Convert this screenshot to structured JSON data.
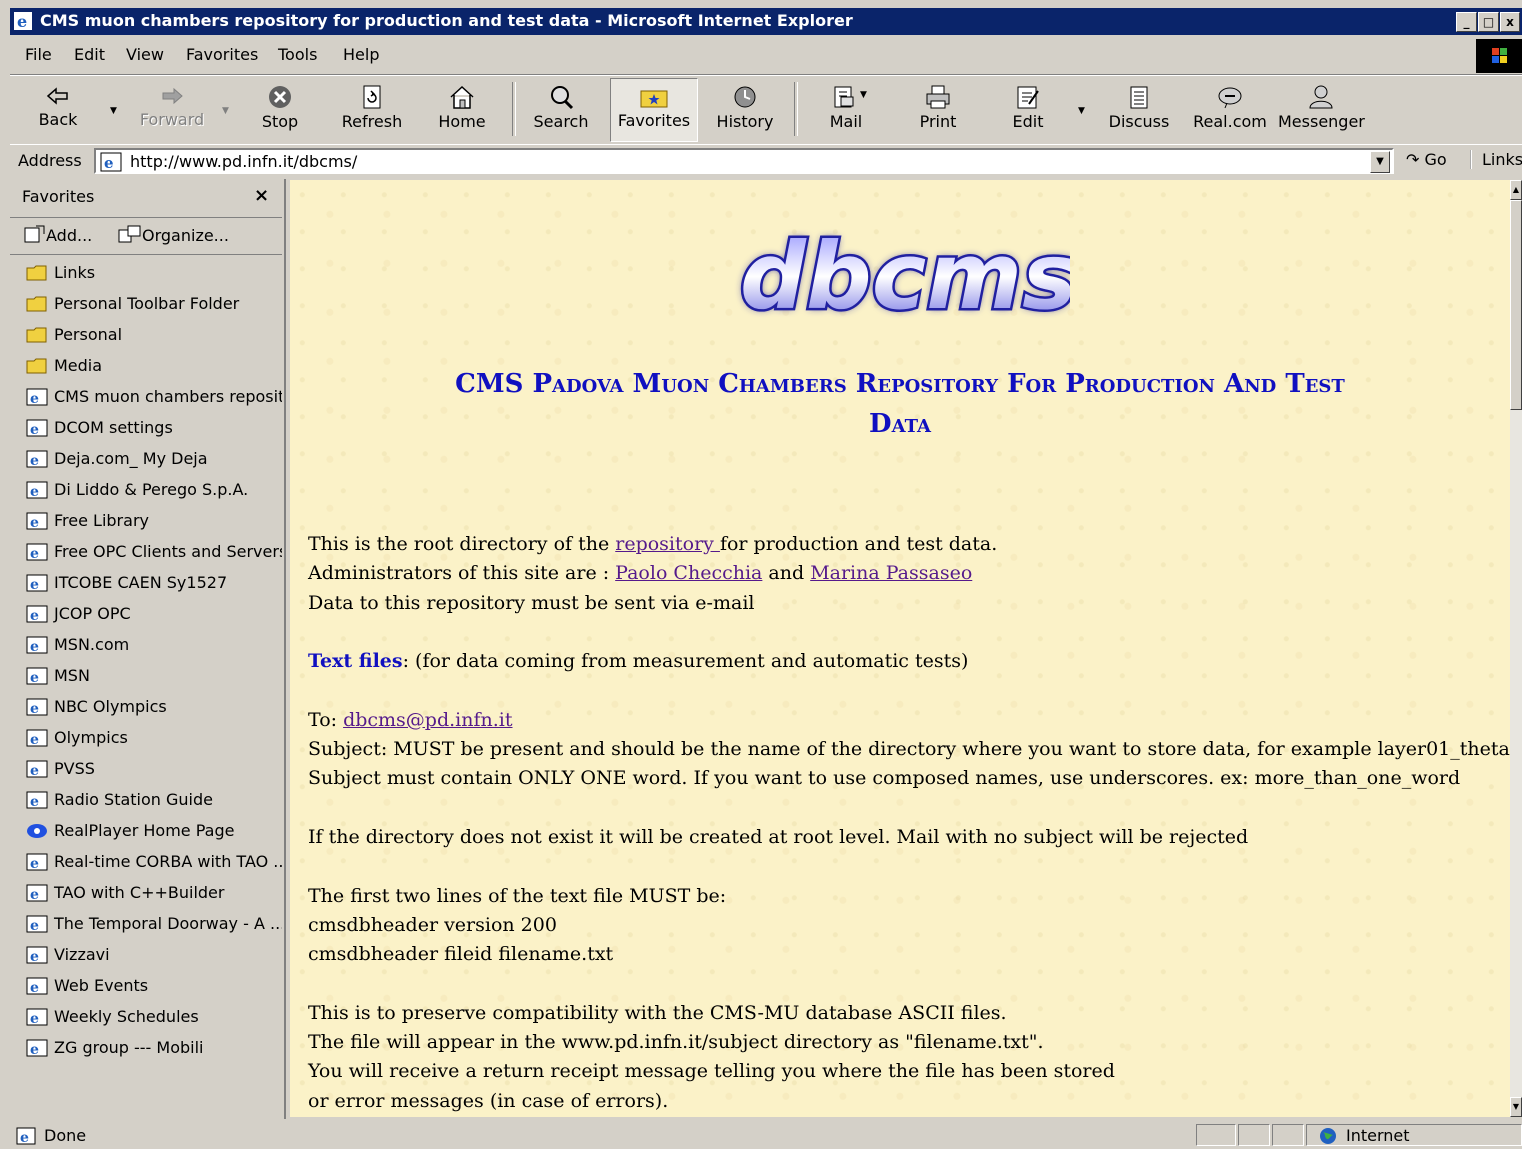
{
  "window": {
    "title": "CMS muon chambers repository for production and test data - Microsoft Internet Explorer",
    "controls": [
      "_",
      "□",
      "x"
    ]
  },
  "menu": [
    "File",
    "Edit",
    "View",
    "Favorites",
    "Tools",
    "Help"
  ],
  "toolbar": {
    "back": "Back",
    "forward": "Forward",
    "stop": "Stop",
    "refresh": "Refresh",
    "home": "Home",
    "search": "Search",
    "favorites": "Favorites",
    "history": "History",
    "mail": "Mail",
    "print": "Print",
    "edit": "Edit",
    "discuss": "Discuss",
    "realcom": "Real.com",
    "messenger": "Messenger"
  },
  "address": {
    "label": "Address",
    "url": "http://www.pd.infn.it/dbcms/",
    "go": "Go",
    "links": "Links"
  },
  "favorites_pane": {
    "title": "Favorites",
    "close": "×",
    "add": "Add...",
    "organize": "Organize...",
    "items": [
      {
        "label": "Links",
        "type": "folder"
      },
      {
        "label": "Personal Toolbar Folder",
        "type": "folder"
      },
      {
        "label": "Personal",
        "type": "folder"
      },
      {
        "label": "Media",
        "type": "folder"
      },
      {
        "label": "CMS muon chambers reposit...",
        "type": "page"
      },
      {
        "label": "DCOM settings",
        "type": "page"
      },
      {
        "label": "Deja.com_ My Deja",
        "type": "page"
      },
      {
        "label": "Di Liddo & Perego S.p.A.",
        "type": "page"
      },
      {
        "label": "Free Library",
        "type": "page"
      },
      {
        "label": "Free OPC Clients and Servers",
        "type": "page"
      },
      {
        "label": "ITCOBE CAEN Sy1527",
        "type": "page"
      },
      {
        "label": "JCOP OPC",
        "type": "page"
      },
      {
        "label": "MSN.com",
        "type": "page"
      },
      {
        "label": "MSN",
        "type": "page"
      },
      {
        "label": "NBC Olympics",
        "type": "page"
      },
      {
        "label": "Olympics",
        "type": "page"
      },
      {
        "label": "PVSS",
        "type": "page"
      },
      {
        "label": "Radio Station Guide",
        "type": "page"
      },
      {
        "label": "RealPlayer Home Page",
        "type": "real"
      },
      {
        "label": "Real-time CORBA with TAO ...",
        "type": "page"
      },
      {
        "label": "TAO with C++Builder",
        "type": "page"
      },
      {
        "label": "The Temporal Doorway - A ...",
        "type": "page"
      },
      {
        "label": "Vizzavi",
        "type": "page"
      },
      {
        "label": "Web Events",
        "type": "page"
      },
      {
        "label": "Weekly Schedules",
        "type": "page"
      },
      {
        "label": "ZG group --- Mobili",
        "type": "page"
      }
    ]
  },
  "page": {
    "logo_text": "dbcms",
    "title_line1": "CMS Padova Muon Chambers Repository For Production And Test",
    "title_line2": "Data",
    "p1_pre": "This is the root directory of the ",
    "p1_link": "repository ",
    "p1_post": "for production and test data.",
    "p2_pre": "Administrators of this site are : ",
    "p2_link1": "Paolo Checchia",
    "p2_mid": " and ",
    "p2_link2": "Marina Passaseo",
    "p3": "Data to this repository must be sent via e-mail",
    "p4_bold": "Text files",
    "p4_rest": ": (for data coming from measurement and automatic tests)",
    "p5_pre": "To: ",
    "p5_link": "dbcms@pd.infn.it",
    "p6": "Subject: MUST be present and should be the name of the directory where you want to store data, for example layer01_theta.",
    "p7": "Subject must contain ONLY ONE word. If you want to use composed names, use underscores. ex:  more_than_one_word",
    "p8": "If the directory does not exist it will be created at root level. Mail with no subject will be rejected",
    "p9": "The first two lines of the text file MUST be:",
    "p10": "cmsdbheader version 200",
    "p11": "cmsdbheader fileid filename.txt",
    "p12": "This is to preserve compatibility with the CMS-MU database ASCII files.",
    "p13": "The file will appear in the www.pd.infn.it/subject directory as \"filename.txt\".",
    "p14": "You will receive a return receipt message telling you where the file has been stored",
    "p15": "or error messages (in case of errors)."
  },
  "status": {
    "text": "Done",
    "zone": "Internet"
  },
  "colors": {
    "titlebar": "#0a246a",
    "page_bg": "#fbf2c8",
    "heading": "#1010c0",
    "link_visited": "#551a8b"
  }
}
